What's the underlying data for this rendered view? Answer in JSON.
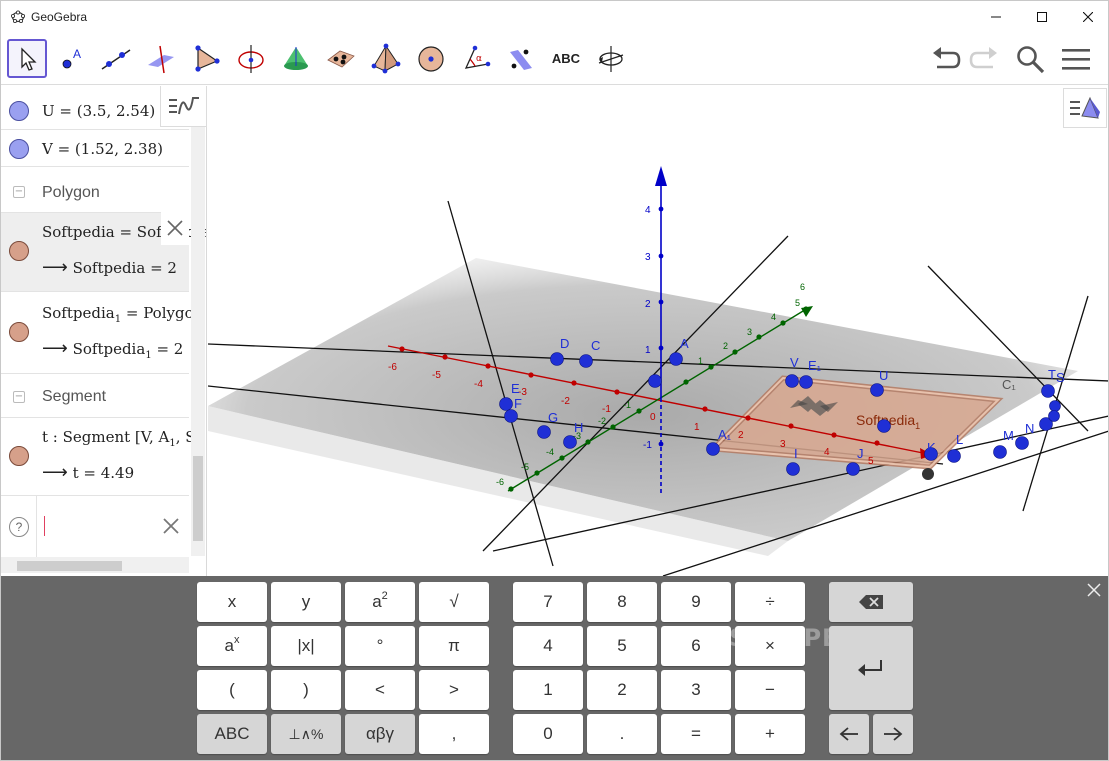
{
  "window": {
    "title": "GeoGebra",
    "controls": [
      "minimize",
      "maximize",
      "close"
    ]
  },
  "toolbar": {
    "tools": [
      {
        "name": "move-tool",
        "active": true
      },
      {
        "name": "point-tool"
      },
      {
        "name": "line-tool"
      },
      {
        "name": "perpendicular-line-tool"
      },
      {
        "name": "polygon-tool"
      },
      {
        "name": "circle-tool"
      },
      {
        "name": "cone-tool"
      },
      {
        "name": "intersect-tool"
      },
      {
        "name": "pyramid-tool"
      },
      {
        "name": "sphere-tool"
      },
      {
        "name": "angle-tool"
      },
      {
        "name": "reflect-tool"
      },
      {
        "name": "text-tool",
        "label": "ABC"
      },
      {
        "name": "rotate-view-tool"
      }
    ],
    "right": [
      "undo-icon",
      "redo-icon",
      "search-icon",
      "menu-icon"
    ]
  },
  "algebra": {
    "items": [
      {
        "kind": "object",
        "text": "U = (3.5, 2.54)",
        "color": "blue"
      },
      {
        "kind": "object",
        "text": "V = (1.52, 2.38)",
        "color": "blue"
      },
      {
        "kind": "category",
        "text": "Polygon"
      },
      {
        "kind": "object",
        "text": "Softpedia = Softpedia",
        "result": "Softpedia = 2",
        "color": "brown",
        "selected": true
      },
      {
        "kind": "object",
        "text": "Softpedia",
        "sub": "1",
        "text_rest": " = Polygon",
        "result_prefix": "Softpedia",
        "result_sub": "1",
        "result_rest": " = 2",
        "color": "brown"
      },
      {
        "kind": "category",
        "text": "Segment"
      },
      {
        "kind": "object",
        "text": "t : Segment [V, A",
        "sub": "1",
        "text_rest": ", S",
        "result": "t = 4.49",
        "color": "brown"
      }
    ],
    "input": {
      "help": "?",
      "value": ""
    }
  },
  "graphics": {
    "axis_labels_x": [
      "-6",
      "-5",
      "-4",
      "-3",
      "-2",
      "-1",
      "0",
      "1",
      "2",
      "3",
      "4",
      "5"
    ],
    "axis_labels_z": [
      "4",
      "3",
      "2",
      "1",
      "-1"
    ],
    "axis_labels_y": [
      "-6",
      "-5",
      "-4",
      "-3",
      "-2",
      "-1",
      "1",
      "2",
      "3",
      "4",
      "5",
      "6"
    ],
    "points": [
      "D",
      "C",
      "A",
      "V",
      "E₁",
      "U",
      "E",
      "F",
      "G",
      "H",
      "A₁",
      "I",
      "J",
      "K",
      "L",
      "M",
      "N",
      "C₁",
      "T",
      "S"
    ],
    "polygon_label": "Softpedia",
    "polygon_label_sub": "1",
    "colors": {
      "x_axis": "#c00000",
      "y_axis": "#006400",
      "z_axis": "#0000c8",
      "point": "#1f2fd6",
      "polygon": "#d9a890"
    }
  },
  "keyboard": {
    "left_keys": [
      [
        "x",
        "y",
        "a2",
        "√"
      ],
      [
        "ax",
        "|x|",
        "°",
        "π"
      ],
      [
        "(",
        ")",
        "<",
        ">"
      ],
      [
        "ABC",
        "⊥∧%",
        "αβγ",
        ","
      ]
    ],
    "num_keys": [
      [
        "7",
        "8",
        "9",
        "÷"
      ],
      [
        "4",
        "5",
        "6",
        "×"
      ],
      [
        "1",
        "2",
        "3",
        "−"
      ],
      [
        "0",
        ".",
        "=",
        "+"
      ]
    ],
    "watermark": "SOFTPEDIA",
    "watermark_mark": "®"
  }
}
